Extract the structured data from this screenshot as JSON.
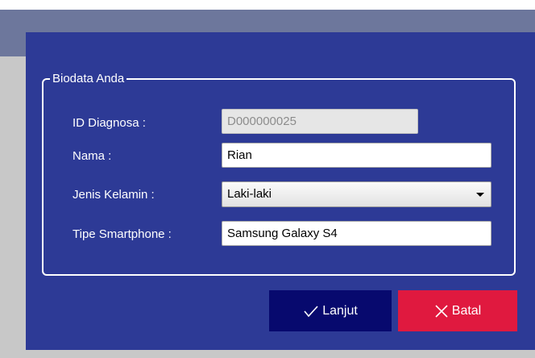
{
  "form": {
    "group_title": "Biodata Anda",
    "fields": {
      "id_diagnosa": {
        "label": "ID Diagnosa :",
        "value": "D000000025"
      },
      "nama": {
        "label": "Nama :",
        "value": "Rian"
      },
      "jenis_kelamin": {
        "label": "Jenis Kelamin :",
        "value": "Laki-laki"
      },
      "tipe_smartphone": {
        "label": "Tipe Smartphone :",
        "value": "Samsung Galaxy S4"
      }
    }
  },
  "buttons": {
    "lanjut": {
      "label": "Lanjut",
      "icon": "checkmark-icon",
      "color": "#07096e"
    },
    "batal": {
      "label": "Batal",
      "icon": "close-icon",
      "color": "#e0193f"
    }
  },
  "colors": {
    "dialog_bg": "#2d3a96",
    "title_strip": "#6d779c",
    "backdrop": "#c8c8c8"
  }
}
